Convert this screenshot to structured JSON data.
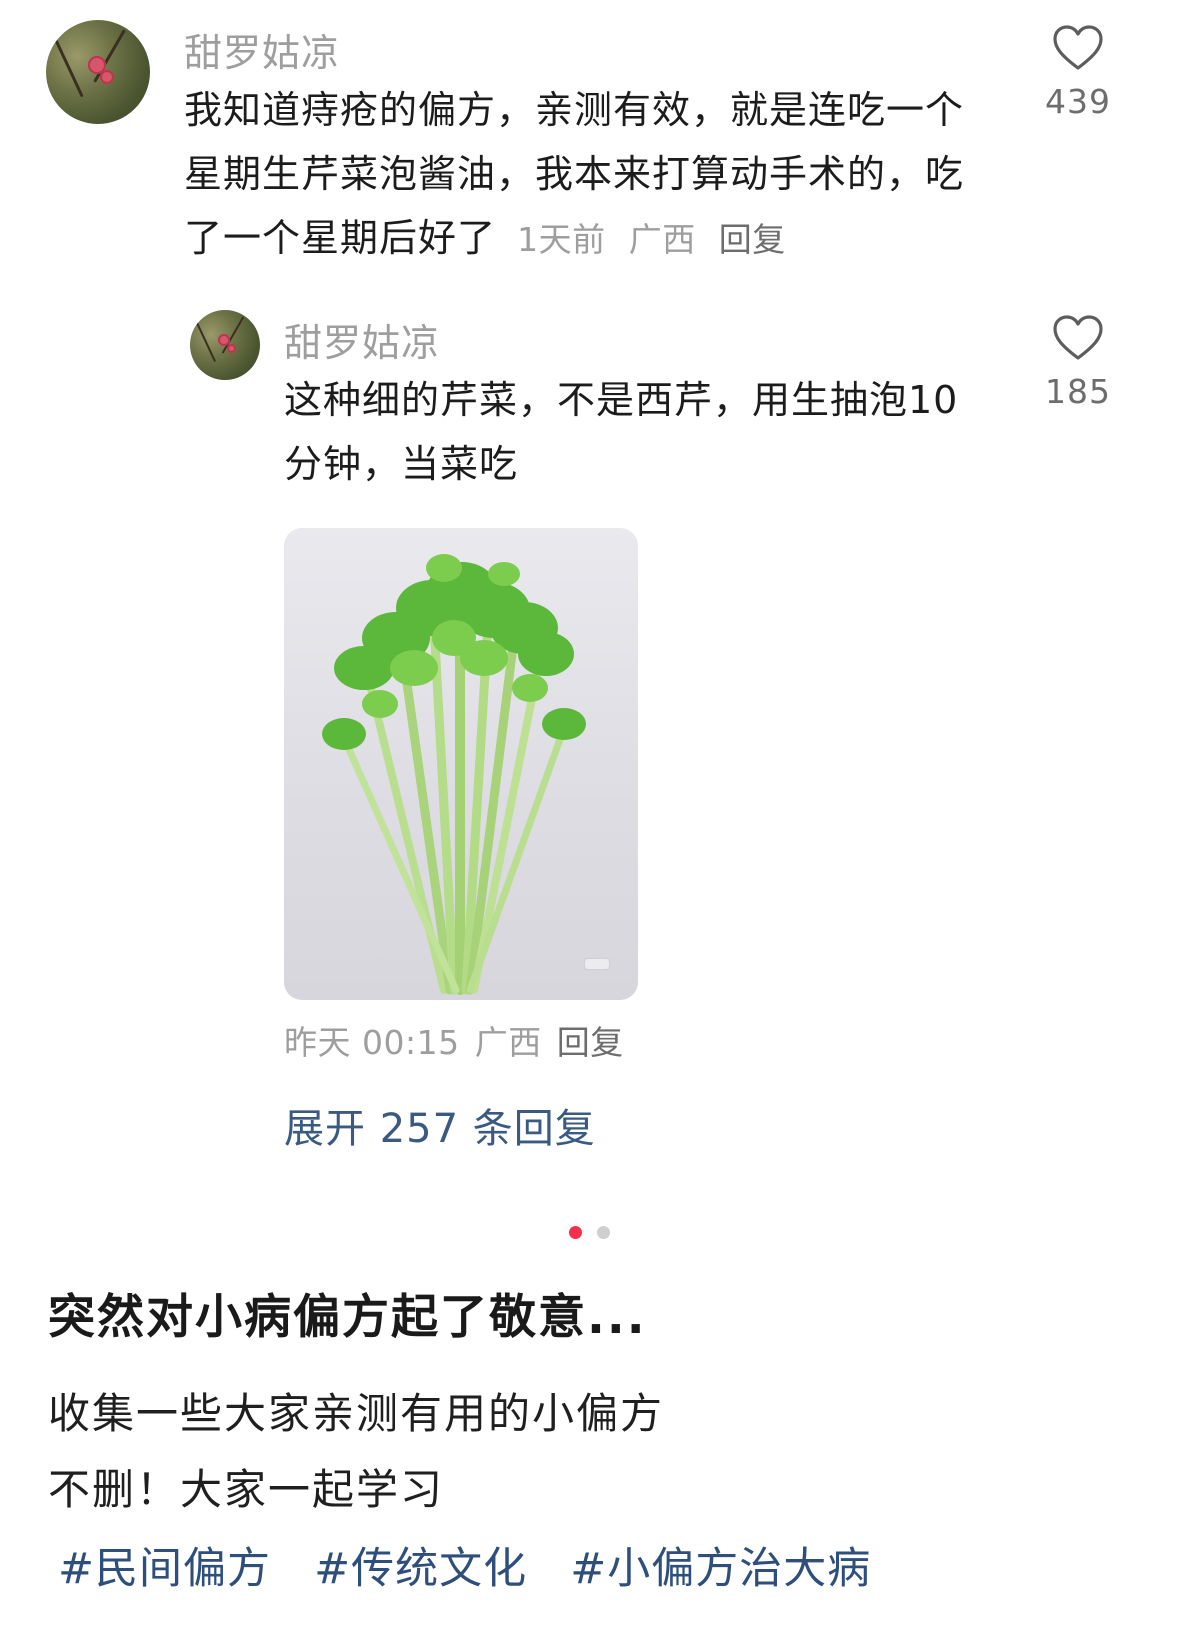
{
  "comment": {
    "username": "甜罗姑凉",
    "text": "我知道痔疮的偏方，亲测有效，就是连吃一个星期生芹菜泡酱油，我本来打算动手术的，吃了一个星期后好了",
    "time": "1天前",
    "location": "广西",
    "reply_label": "回复",
    "likes": "439"
  },
  "reply": {
    "username": "甜罗姑凉",
    "text": "这种细的芹菜，不是西芹，用生抽泡10分钟，当菜吃",
    "time": "昨天 00:15",
    "location": "广西",
    "reply_label": "回复",
    "likes": "185",
    "image_subject": "celery-bunch"
  },
  "expand_replies": "展开 257 条回复",
  "carousel": {
    "pages": 2,
    "active": 1,
    "active_color": "#f0314a",
    "inactive_color": "#cfcfcf"
  },
  "post": {
    "title": "突然对小病偏方起了敬意...",
    "lines": [
      "收集一些大家亲测有用的小偏方",
      "不删！大家一起学习"
    ],
    "tags": [
      "#民间偏方",
      "#传统文化",
      "#小偏方治大病"
    ]
  },
  "colors": {
    "link": "#3b5a82",
    "tag": "#2e4f7c",
    "muted": "#9e9e9e"
  },
  "icons": {
    "like": "heart-outline-icon"
  }
}
